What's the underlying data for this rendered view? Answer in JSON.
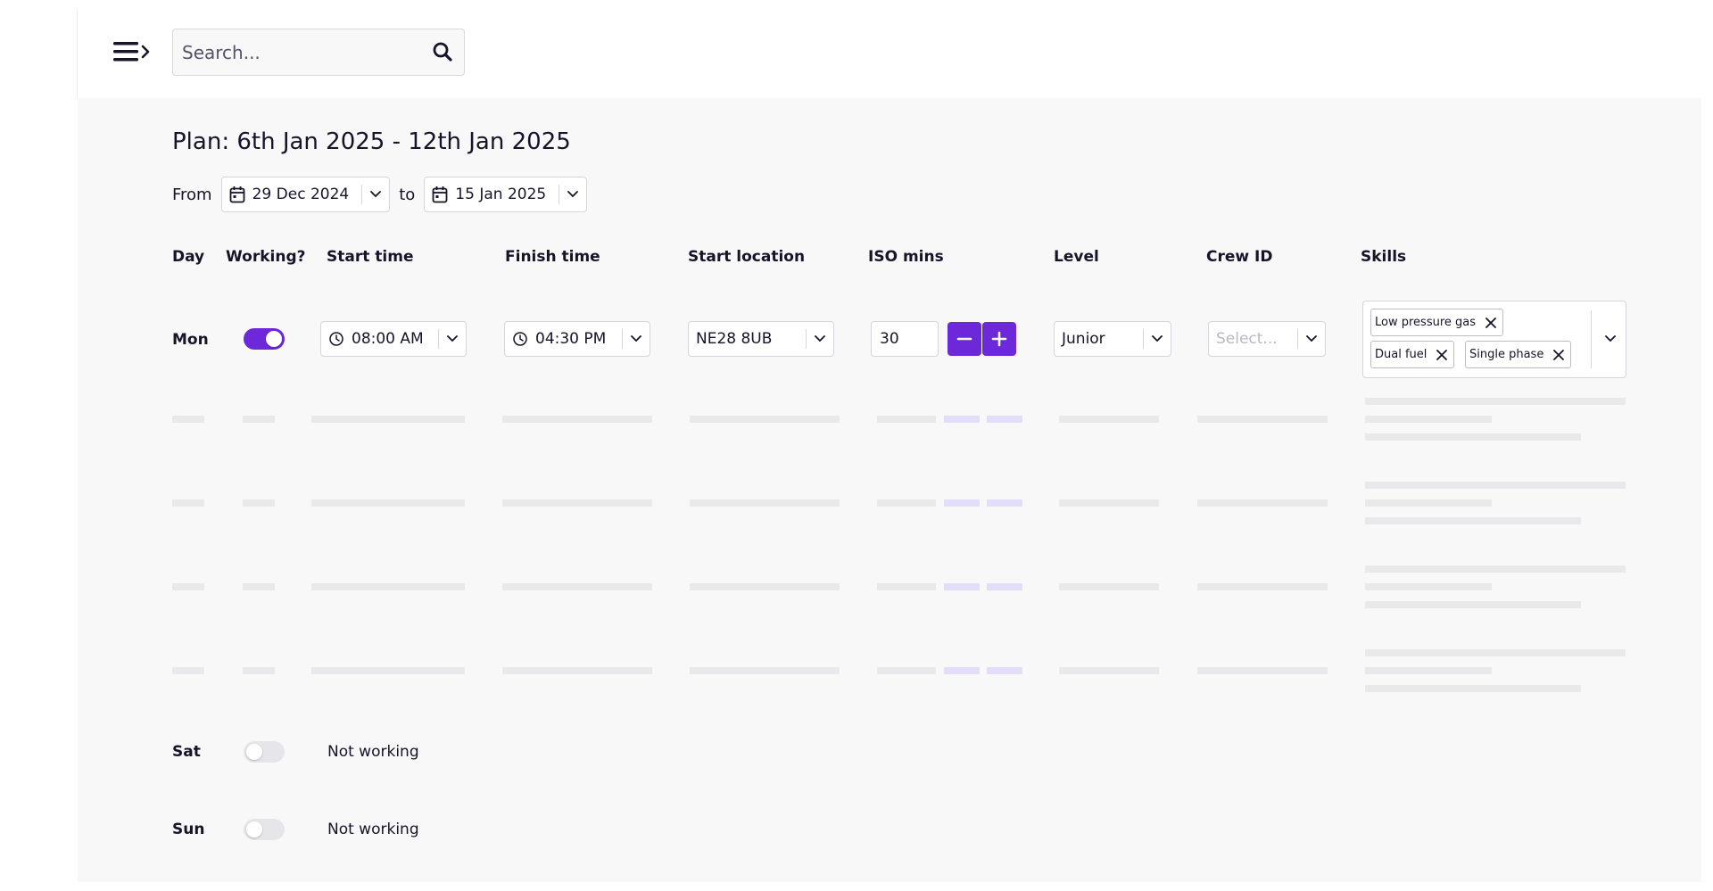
{
  "header": {
    "search": {
      "placeholder": "Search..."
    },
    "icons": {
      "menu": "menu-expand-icon",
      "search": "search-icon"
    }
  },
  "plan": {
    "title": "Plan: 6th Jan 2025 - 12th Jan 2025",
    "from_label": "From",
    "to_label": "to",
    "from_date": "29 Dec 2024",
    "to_date": "15 Jan 2025"
  },
  "columns": {
    "day": "Day",
    "working": "Working?",
    "start_time": "Start time",
    "finish_time": "Finish time",
    "start_location": "Start location",
    "iso_mins": "ISO mins",
    "level": "Level",
    "crew_id": "Crew ID",
    "skills": "Skills"
  },
  "rows": {
    "mon": {
      "day": "Mon",
      "working": true,
      "start_time": "08:00 AM",
      "finish_time": "04:30 PM",
      "start_location": "NE28 8UB",
      "iso_mins": "30",
      "level": "Junior",
      "crew_id_placeholder": "Select...",
      "skills": [
        "Low pressure gas",
        "Dual fuel",
        "Single phase"
      ]
    },
    "sat": {
      "day": "Sat",
      "working": false,
      "status": "Not working"
    },
    "sun": {
      "day": "Sun",
      "working": false,
      "status": "Not working"
    }
  },
  "loading_rows": 4,
  "colors": {
    "accent": "#6d28d9",
    "skeleton": "#e9e9ec",
    "skeleton_accent": "#e3ddfa",
    "background": "#f8f8f8"
  }
}
